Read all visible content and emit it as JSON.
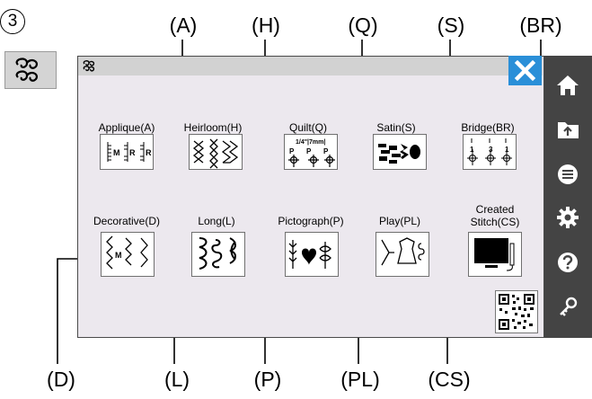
{
  "step_number": "3",
  "callouts": {
    "top": [
      "(A)",
      "(H)",
      "(Q)",
      "(S)",
      "(BR)"
    ],
    "bottom": [
      "(D)",
      "(L)",
      "(P)",
      "(PL)",
      "(CS)"
    ]
  },
  "categories_row1": [
    {
      "label": "Applique(A)",
      "pattern": "applique-pattern-icon"
    },
    {
      "label": "Heirloom(H)",
      "pattern": "heirloom-pattern-icon"
    },
    {
      "label": "Quilt(Q)",
      "pattern": "quilt-pattern-icon"
    },
    {
      "label": "Satin(S)",
      "pattern": "satin-pattern-icon"
    },
    {
      "label": "Bridge(BR)",
      "pattern": "bridge-pattern-icon"
    }
  ],
  "categories_row2": [
    {
      "label": "Decorative(D)",
      "pattern": "decorative-pattern-icon"
    },
    {
      "label": "Long(L)",
      "pattern": "long-pattern-icon"
    },
    {
      "label": "Pictograph(P)",
      "pattern": "pictograph-pattern-icon"
    },
    {
      "label": "Play(PL)",
      "pattern": "play-pattern-icon"
    },
    {
      "label_line1": "Created",
      "label_line2": "Stitch(CS)",
      "pattern": "monitor-icon"
    }
  ],
  "tile_text": {
    "applique": [
      "M",
      "R",
      "R"
    ],
    "quilt_top": "1/4\"|7mm|",
    "quilt_letters": [
      "P",
      "P",
      "P"
    ],
    "bridge_nums": [
      "1",
      "3",
      "1"
    ],
    "decorative_letter": "M"
  },
  "sidebar_icons": [
    "home-icon",
    "folder-upload-icon",
    "menu-icon",
    "settings-icon",
    "help-icon",
    "key-icon"
  ],
  "colors": {
    "screen_bg": "#ece8ee",
    "sidebar_bg": "#444444",
    "close_bg": "#2a8fd8",
    "titlebar_bg": "#d2d2d2"
  }
}
